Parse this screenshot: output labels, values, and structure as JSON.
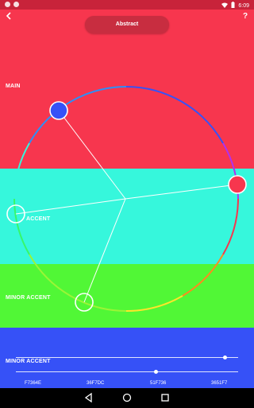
{
  "status_bar": {
    "time": "6:09"
  },
  "header": {
    "title": "Abstract",
    "help_label": "?"
  },
  "bands": [
    {
      "label": "MAIN",
      "color": "#F7364E"
    },
    {
      "label": "ACCENT",
      "color": "#36F7DC"
    },
    {
      "label": "MINOR ACCENT",
      "color": "#51F736"
    },
    {
      "label": "MINOR ACCENT",
      "color": "#3651F7"
    }
  ],
  "hex_values": [
    "F7364E",
    "36F7DC",
    "51F736",
    "3651F7"
  ],
  "sliders": [
    {
      "name": "slider-1",
      "value": 0.94
    },
    {
      "name": "slider-2",
      "value": 0.63
    }
  ],
  "icons": {
    "back": "arrow-back-icon",
    "help": "help-icon",
    "nav_back": "nav-back-icon",
    "nav_home": "nav-home-icon",
    "nav_recents": "nav-recents-icon"
  }
}
